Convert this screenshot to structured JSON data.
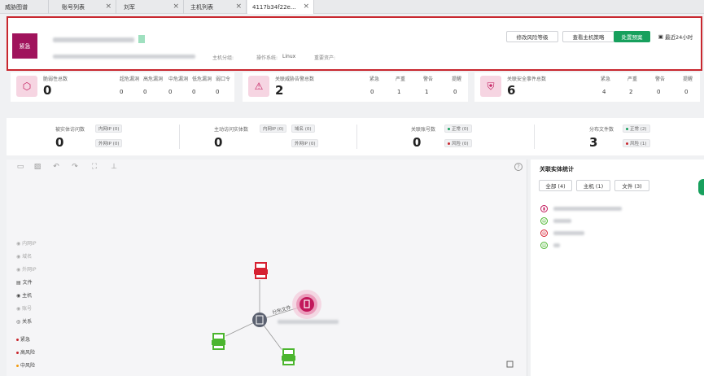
{
  "tabs": [
    {
      "label": "威胁图谱",
      "active": false
    },
    {
      "label": "账号列表",
      "active": false
    },
    {
      "label": "刘军",
      "active": false
    },
    {
      "label": "主机列表",
      "active": false
    },
    {
      "label": "4117b34f22e...",
      "active": true
    }
  ],
  "header": {
    "badge": "紧急",
    "host_group_label": "主机分组:",
    "os_label": "操作系统:",
    "os_value": "Linux",
    "asset_label": "重要资产:",
    "buttons": {
      "modify_risk": "修改风险等级",
      "view_policy": "查看主机策略",
      "handle_plan": "处置预案",
      "time_range": "最近24小时"
    }
  },
  "stats": {
    "vuln": {
      "title": "脆弱性总数",
      "total": "0",
      "cols": [
        {
          "label": "超危漏洞",
          "value": "0"
        },
        {
          "label": "高危漏洞",
          "value": "0"
        },
        {
          "label": "中危漏洞",
          "value": "0"
        },
        {
          "label": "低危漏洞",
          "value": "0"
        },
        {
          "label": "弱口令",
          "value": "0"
        }
      ]
    },
    "threat": {
      "title": "关联威胁告警总数",
      "total": "2",
      "cols": [
        {
          "label": "紧急",
          "value": "0"
        },
        {
          "label": "严重",
          "value": "1"
        },
        {
          "label": "警告",
          "value": "1"
        },
        {
          "label": "提醒",
          "value": "0"
        }
      ]
    },
    "event": {
      "title": "关联安全事件总数",
      "total": "6",
      "cols": [
        {
          "label": "紧急",
          "value": "4"
        },
        {
          "label": "严重",
          "value": "2"
        },
        {
          "label": "警告",
          "value": "0"
        },
        {
          "label": "提醒",
          "value": "0"
        }
      ]
    }
  },
  "entity_stats": {
    "visited": {
      "title": "被实体访问数",
      "total": "0",
      "tags": [
        "内网IP (0)",
        "外网IP (0)"
      ]
    },
    "active": {
      "title": "主动访问实体数",
      "total": "0",
      "tags": [
        "内网IP (0)",
        "域名 (0)",
        "外网IP (0)"
      ]
    },
    "accounts": {
      "title": "关联账号数",
      "total": "0",
      "tags": [
        "正常 (0)",
        "风险 (0)"
      ]
    },
    "files": {
      "title": "分布文件数",
      "total": "3",
      "tags": [
        "正常 (2)",
        "风险 (1)"
      ]
    }
  },
  "graph": {
    "legend": [
      {
        "label": "内网IP",
        "active": false
      },
      {
        "label": "域名",
        "active": false
      },
      {
        "label": "外网IP",
        "active": false
      },
      {
        "label": "文件",
        "active": true
      },
      {
        "label": "主机",
        "active": true
      },
      {
        "label": "账号",
        "active": false
      },
      {
        "label": "关系",
        "active": true
      }
    ],
    "severity": [
      {
        "label": "紧急",
        "color": "#c8272e"
      },
      {
        "label": "高风险",
        "color": "#c8272e"
      },
      {
        "label": "中风险",
        "color": "#f39c12"
      }
    ],
    "edge_label": "分布文件",
    "help": "?"
  },
  "panel": {
    "title": "关联实体统计",
    "filters": [
      "全部 (4)",
      "主机 (1)",
      "文件 (3)"
    ]
  },
  "colors": {
    "urgent": "#a0135c",
    "danger": "#c8272e",
    "success": "#17a05d",
    "file_red": "#d62031",
    "file_green": "#4bb52e",
    "host_pink": "#c2185b"
  }
}
